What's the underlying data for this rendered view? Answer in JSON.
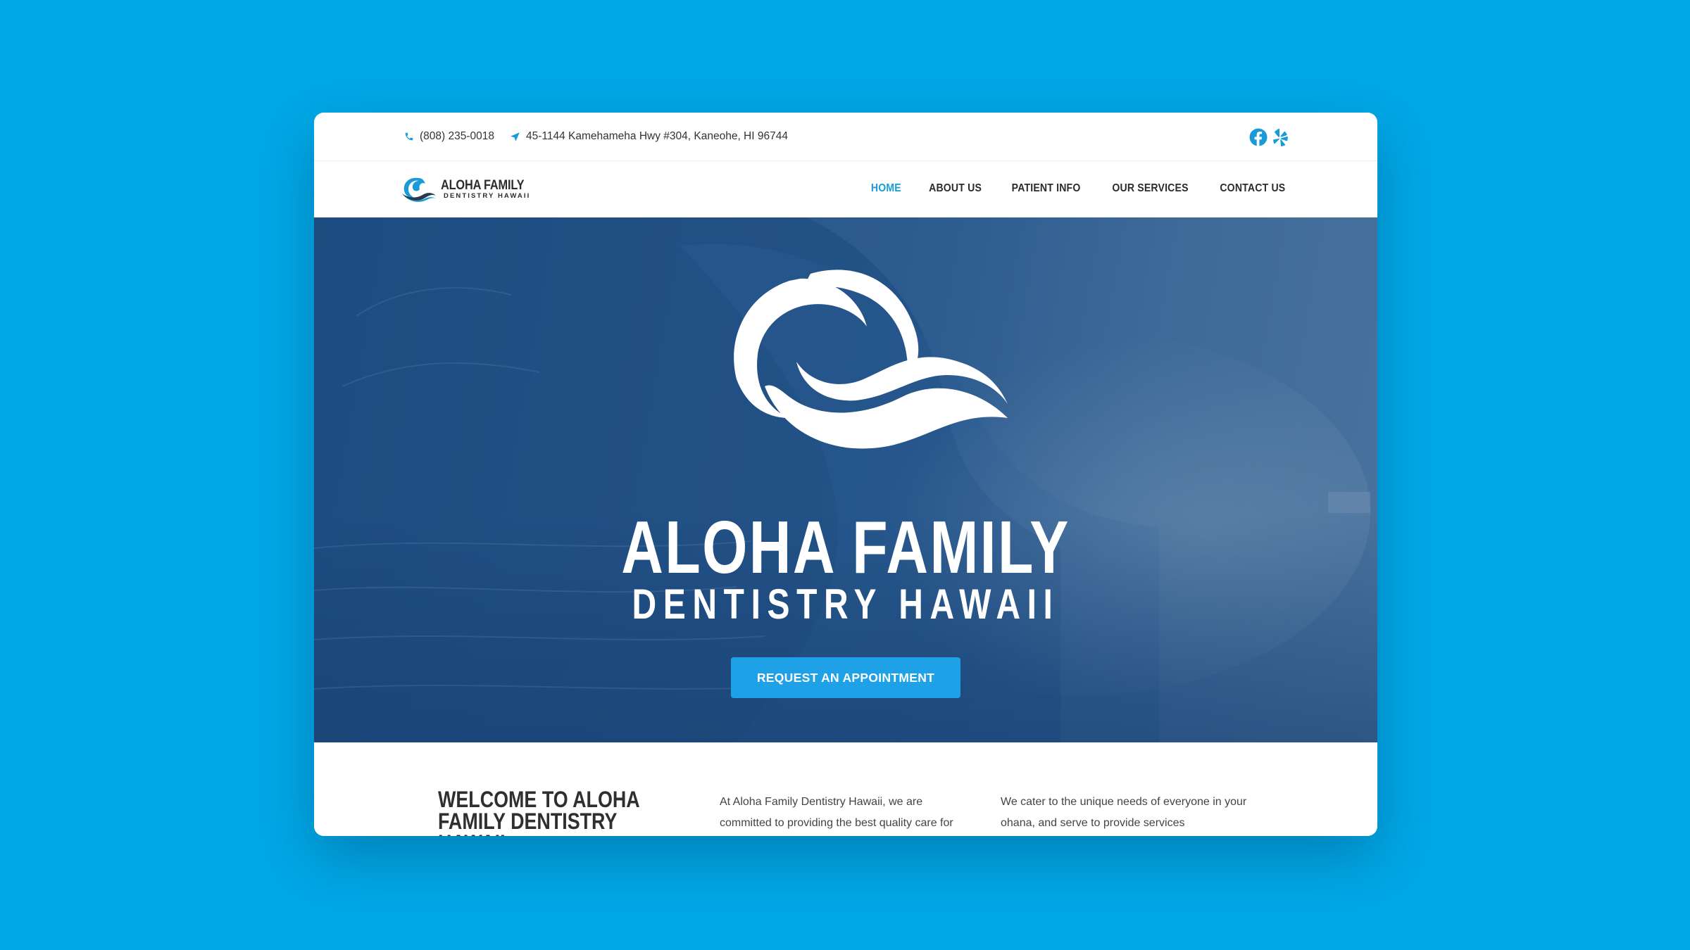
{
  "topbar": {
    "phone": "(808) 235-0018",
    "address": "45-1144 Kamehameha Hwy #304, Kaneohe, HI 96744",
    "social": [
      "facebook-icon",
      "yelp-icon"
    ]
  },
  "brand": {
    "line1": "ALOHA FAMILY",
    "line2": "DENTISTRY HAWAII"
  },
  "nav": {
    "items": [
      {
        "label": "HOME",
        "active": true
      },
      {
        "label": "ABOUT US"
      },
      {
        "label": "PATIENT INFO"
      },
      {
        "label": "OUR SERVICES"
      },
      {
        "label": "CONTACT US"
      }
    ]
  },
  "hero": {
    "title": "ALOHA FAMILY",
    "subtitle": "DENTISTRY HAWAII",
    "cta_label": "REQUEST AN APPOINTMENT"
  },
  "welcome": {
    "heading": "WELCOME TO ALOHA FAMILY DENTISTRY HAWAII",
    "col1": "At Aloha Family Dentistry Hawaii, we are committed to providing the best quality care for",
    "col2": "We cater to the unique needs of everyone in your ohana, and serve to provide services"
  },
  "colors": {
    "background": "#00a8e6",
    "accent": "#1a9bd9",
    "button": "#1ea1e6",
    "hero_overlay": "#24548a",
    "text_dark": "#2b2b2b"
  }
}
